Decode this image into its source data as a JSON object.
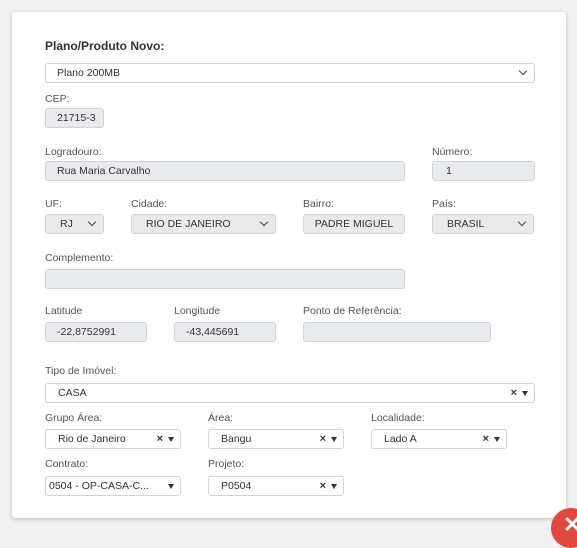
{
  "form": {
    "plano_label": "Plano/Produto Novo:",
    "plano_value": "Plano 200MB",
    "cep_label": "CEP:",
    "cep_value": "21715-3",
    "logradouro_label": "Logradouro:",
    "logradouro_value": "Rua Maria Carvalho",
    "numero_label": "Número:",
    "numero_value": "1",
    "uf_label": "UF:",
    "uf_value": "RJ",
    "cidade_label": "Cidade:",
    "cidade_value": "RIO DE JANEIRO",
    "bairro_label": "Bairro:",
    "bairro_value": "PADRE MIGUEL",
    "pais_label": "País:",
    "pais_value": "BRASIL",
    "complemento_label": "Complemento:",
    "complemento_value": "",
    "latitude_label": "Latitude",
    "latitude_value": "-22,8752991",
    "longitude_label": "Longitude",
    "longitude_value": "-43,445691",
    "referencia_label": "Ponto de Referência:",
    "referencia_value": "",
    "tipo_imovel_label": "Tipo de Imóvel:",
    "tipo_imovel_value": "CASA",
    "grupo_area_label": "Grupo Área:",
    "grupo_area_value": "Rio de Janeiro",
    "area_label": "Área:",
    "area_value": "Bangu",
    "localidade_label": "Localidade:",
    "localidade_value": "Lado A",
    "contrato_label": "Contrato:",
    "contrato_value": "0504 - OP-CASA-C...",
    "projeto_label": "Projeto:",
    "projeto_value": "P0504",
    "clear_glyph": "×"
  },
  "close_button": {
    "glyph": "✕",
    "color": "#e0483d",
    "icon": "close-icon"
  }
}
